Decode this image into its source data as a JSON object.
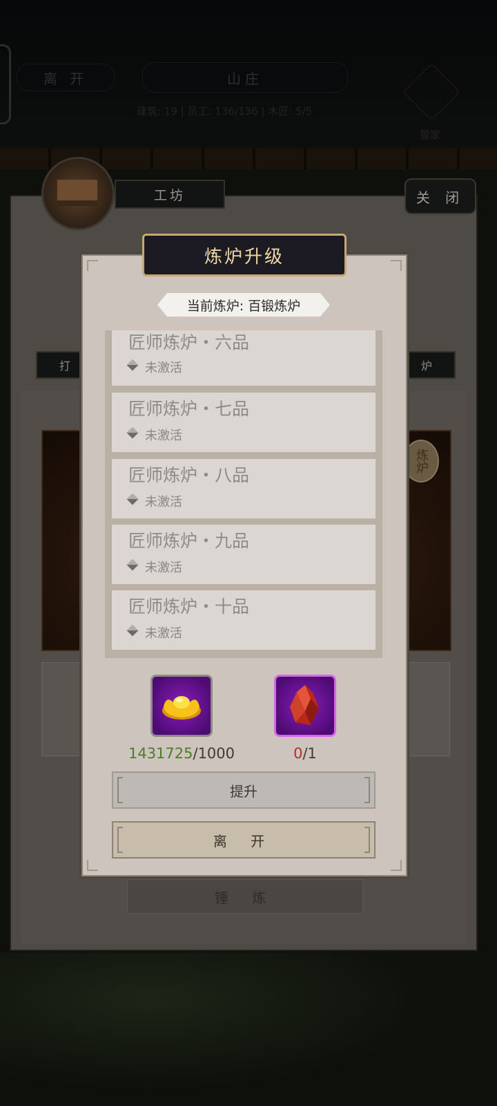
{
  "background": {
    "leave_label": "离 开",
    "location_title": "山庄",
    "stats_text": "建筑: 19 | 员工: 136/136 | 木匠: 5/5",
    "steward_label": "管家",
    "workshop_tab": "工坊",
    "close_label": "关 闭",
    "left_side_tab": "打",
    "right_side_tab": "炉",
    "furnace_seal": "炼炉",
    "forge_button": "锤 炼"
  },
  "modal": {
    "title": "炼炉升级",
    "current_furnace": "当前炼炉: 百锻炼炉",
    "items": [
      {
        "name": "匠师炼炉・六品",
        "status": "未激活"
      },
      {
        "name": "匠师炼炉・七品",
        "status": "未激活"
      },
      {
        "name": "匠师炼炉・八品",
        "status": "未激活"
      },
      {
        "name": "匠师炼炉・九品",
        "status": "未激活"
      },
      {
        "name": "匠师炼炉・十品",
        "status": "未激活"
      }
    ],
    "costs": [
      {
        "icon": "gold-ingot-icon",
        "have": "1431725",
        "need": "/1000",
        "have_color": "#4d7d2a"
      },
      {
        "icon": "red-crystal-icon",
        "have": "0",
        "need": "/1",
        "have_color": "#b23228"
      }
    ],
    "upgrade_button": "提升",
    "leave_button": "离 开"
  }
}
